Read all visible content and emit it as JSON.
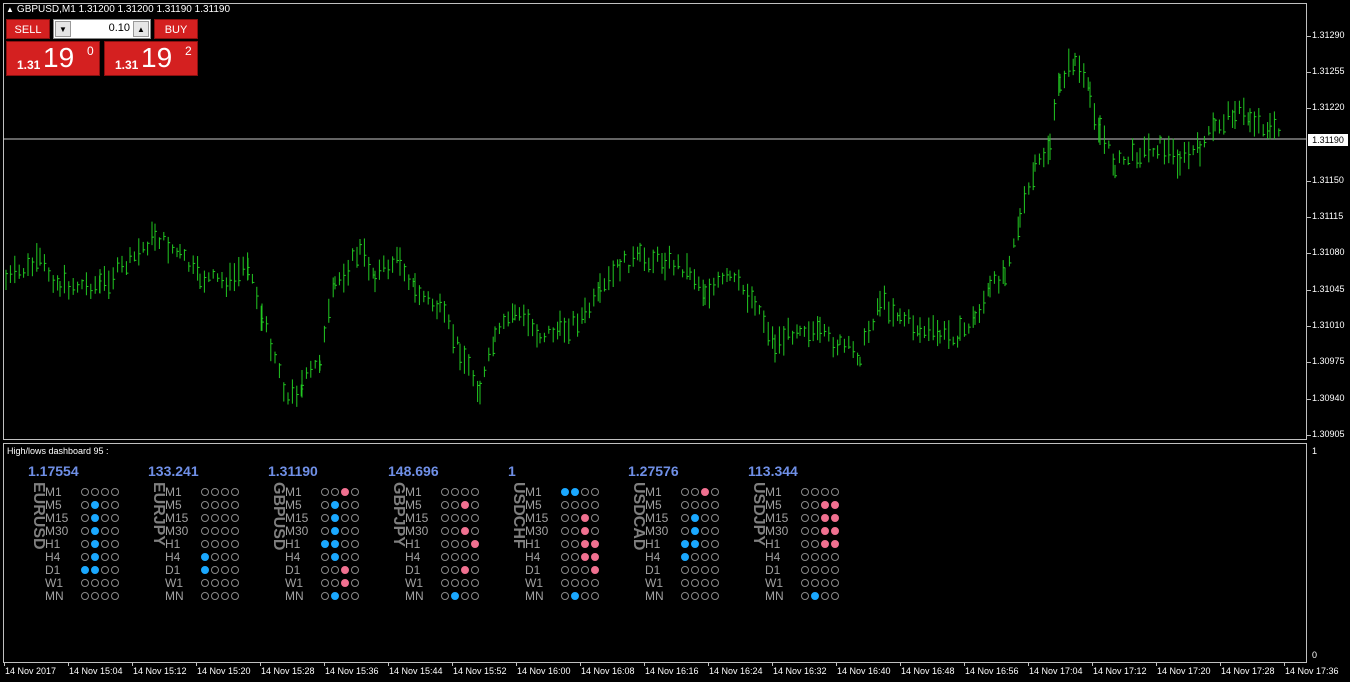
{
  "chart": {
    "title": "GBPUSD,M1  1.31200 1.31200 1.31190 1.31190",
    "current_price_label": "1.31190",
    "line_color": "#21c821",
    "price_axis": [
      "1.31290",
      "1.31255",
      "1.31220",
      "1.31150",
      "1.31115",
      "1.31080",
      "1.31045",
      "1.31010",
      "1.30975",
      "1.30940",
      "1.30905"
    ],
    "time_axis": [
      "14 Nov 2017",
      "14 Nov 15:04",
      "14 Nov 15:12",
      "14 Nov 15:20",
      "14 Nov 15:28",
      "14 Nov 15:36",
      "14 Nov 15:44",
      "14 Nov 15:52",
      "14 Nov 16:00",
      "14 Nov 16:08",
      "14 Nov 16:16",
      "14 Nov 16:24",
      "14 Nov 16:32",
      "14 Nov 16:40",
      "14 Nov 16:48",
      "14 Nov 16:56",
      "14 Nov 17:04",
      "14 Nov 17:12",
      "14 Nov 17:20",
      "14 Nov 17:28",
      "14 Nov 17:36"
    ]
  },
  "trade_panel": {
    "sell_label": "SELL",
    "buy_label": "BUY",
    "lot": "0.10",
    "sell_prefix": "1.31",
    "sell_main": "19",
    "sell_sup": "0",
    "buy_prefix": "1.31",
    "buy_main": "19",
    "buy_sup": "2"
  },
  "indicator": {
    "title": "High/lows dashboard 95 :",
    "scale_top": "1",
    "scale_bottom": "0",
    "timeframes": [
      "M1",
      "M5",
      "M15",
      "M30",
      "H1",
      "H4",
      "D1",
      "W1",
      "MN"
    ],
    "colors": {
      "blue": "#1aa8ff",
      "pink": "#f07090",
      "price": "#6f8fe6"
    },
    "pairs": [
      {
        "pair": "EURUSD",
        "price": "1.17554",
        "dots": [
          "oooo",
          "obo o",
          "obo o",
          "obo o",
          "oboo",
          "oboo",
          "bboo",
          "oooo",
          "oooo"
        ]
      },
      {
        "pair": "EURJPY",
        "price": "133.241",
        "dots": [
          "oooo",
          "oooo",
          "oooo",
          "oooo",
          "oooo",
          "booo",
          "booo",
          "oooo",
          "oooo"
        ]
      },
      {
        "pair": "GBPUSD",
        "price": "1.31190",
        "dots": [
          "oopo",
          "oboo",
          "oboo",
          "oboo",
          "bboo",
          "oboo",
          "oopo",
          "oopo",
          "oboo"
        ]
      },
      {
        "pair": "GBPJPY",
        "price": "148.696",
        "dots": [
          "oooo",
          "oopo",
          "oooo",
          "oopo",
          "ooop",
          "oooo",
          "oopo",
          "oooo",
          "oboo"
        ]
      },
      {
        "pair": "USDCHF",
        "price": "1",
        "dots": [
          "bboo",
          "oooo",
          "oopo",
          "oopo",
          "oopp",
          "oopp",
          "ooop",
          "oooo",
          "oboo"
        ]
      },
      {
        "pair": "USDCAD",
        "price": "1.27576",
        "dots": [
          "oopo",
          "oooo",
          "oboo",
          "oboo",
          "bboo",
          "booo",
          "oooo",
          "oooo",
          "oooo"
        ]
      },
      {
        "pair": "USDJPY",
        "price": "113.344",
        "dots": [
          "oooo",
          "oopp",
          "oopp",
          "oopp",
          "oopp",
          "oooo",
          "oooo",
          "oooo",
          "oboo"
        ]
      }
    ]
  }
}
